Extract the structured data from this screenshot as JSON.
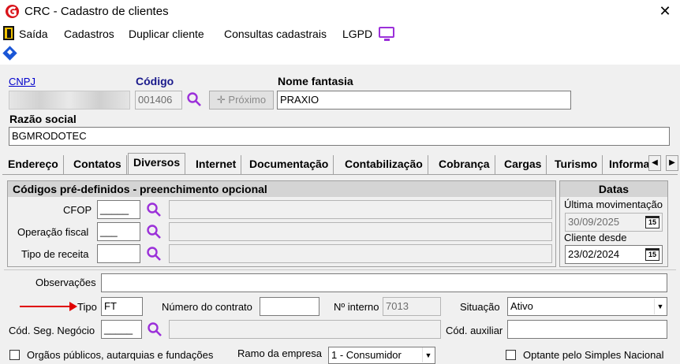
{
  "window": {
    "title": "CRC - Cadastro de clientes",
    "close_glyph": "✕"
  },
  "menu": {
    "exit_label": "Saída",
    "items": [
      "Cadastros",
      "Duplicar cliente",
      "Consultas cadastrais",
      "LGPD"
    ]
  },
  "header": {
    "cnpj_label": "CNPJ",
    "cnpj_value": "",
    "codigo_label": "Código",
    "codigo_value": "001406",
    "proximo_label": "✛ Próximo",
    "nome_fantasia_label": "Nome fantasia",
    "nome_fantasia_value": "PRAXIO",
    "razao_social_label": "Razão social",
    "razao_social_value": "BGMRODOTEC"
  },
  "tabs": [
    "Endereço",
    "Contatos",
    "Diversos",
    "Internet",
    "Documentação",
    "Contabilização",
    "Cobrança",
    "Cargas",
    "Turismo",
    "Informa"
  ],
  "tab_scroll": {
    "left": "◀",
    "right": "▶"
  },
  "codigos_group": {
    "title": "Códigos pré-definidos - preenchimento opcional",
    "rows": [
      {
        "label": "CFOP",
        "code": "_____",
        "description": ""
      },
      {
        "label": "Operação fiscal",
        "code": "___",
        "description": ""
      },
      {
        "label": "Tipo de receita",
        "code": "",
        "description": ""
      }
    ]
  },
  "datas_group": {
    "title": "Datas",
    "ultima_mov_label": "Última movimentação",
    "ultima_mov_value": "30/09/2025",
    "cliente_desde_label": "Cliente desde",
    "cliente_desde_value": "23/02/2024",
    "calendar_glyph": "15"
  },
  "details": {
    "observacoes_label": "Observações",
    "observacoes_value": "",
    "tipo_label": "Tipo",
    "tipo_value": "FT",
    "numero_contrato_label": "Número do contrato",
    "numero_contrato_value": "",
    "n_interno_label": "Nº interno",
    "n_interno_value": "7013",
    "situacao_label": "Situação",
    "situacao_value": "Ativo",
    "cod_seg_label": "Cód. Seg. Negócio",
    "cod_seg_value": "_____",
    "cod_seg_desc": "",
    "cod_auxiliar_label": "Cód. auxiliar",
    "cod_auxiliar_value": "",
    "orgaos_label": "Orgãos públicos, autarquias e fundações",
    "ramo_label": "Ramo da empresa",
    "ramo_value": "1 - Consumidor",
    "optante_label": "Optante pelo Simples Nacional"
  },
  "colors": {
    "accent": "#9b30d9",
    "annotation_arrow": "#e00000",
    "link": "#0000cc"
  }
}
